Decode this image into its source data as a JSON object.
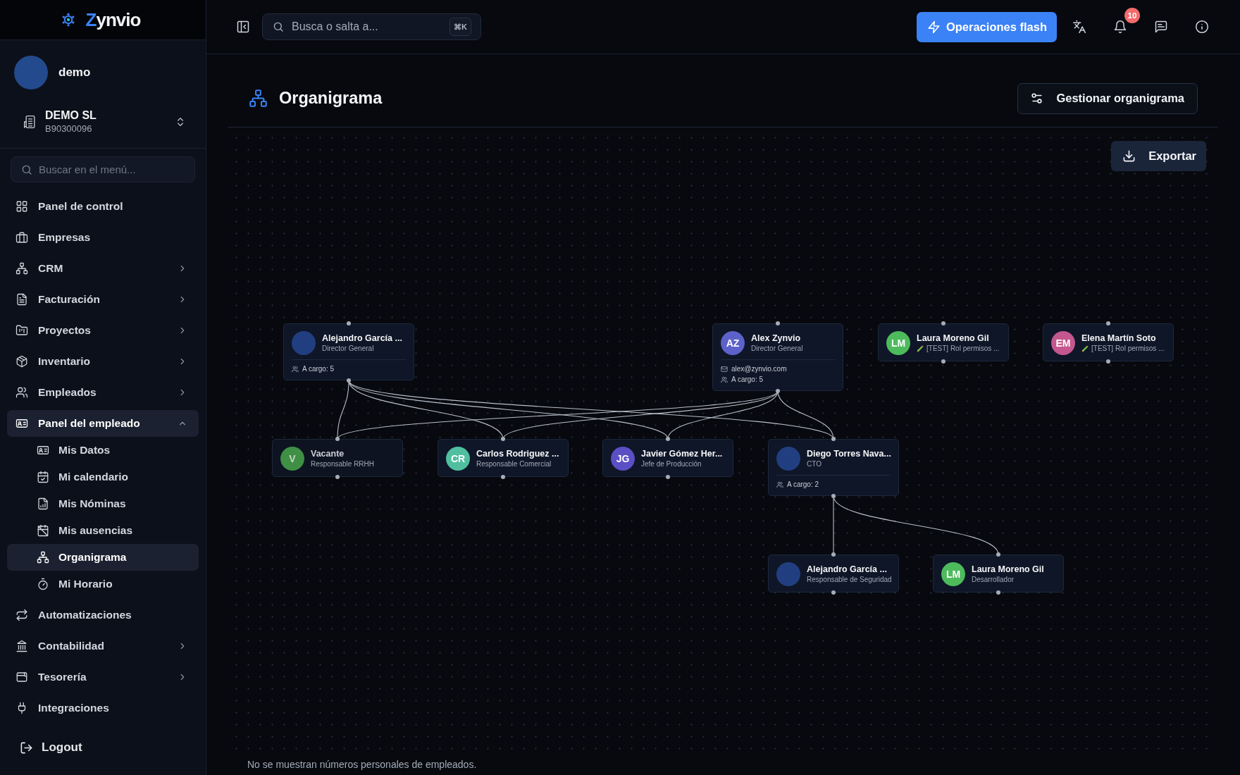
{
  "sidebar": {
    "logo": "Zynvio",
    "user": {
      "name": "demo"
    },
    "company": {
      "name": "DEMO SL",
      "tax_id": "B90300096"
    },
    "search": {
      "placeholder": "Buscar en el menú..."
    },
    "menu": [
      {
        "label": "Panel de control",
        "kind": "link",
        "expanded": false,
        "selected": false
      },
      {
        "label": "Empresas",
        "kind": "link",
        "expanded": false,
        "selected": false
      },
      {
        "label": "CRM",
        "kind": "group",
        "expanded": false,
        "selected": false
      },
      {
        "label": "Facturación",
        "kind": "group",
        "expanded": false,
        "selected": false
      },
      {
        "label": "Proyectos",
        "kind": "group",
        "expanded": false,
        "selected": false
      },
      {
        "label": "Inventario",
        "kind": "group",
        "expanded": false,
        "selected": false
      },
      {
        "label": "Empleados",
        "kind": "group",
        "expanded": false,
        "selected": false
      },
      {
        "label": "Panel del empleado",
        "kind": "group",
        "expanded": true,
        "selected": false,
        "children": [
          {
            "label": "Mis Datos",
            "selected": false
          },
          {
            "label": "Mi calendario",
            "selected": false
          },
          {
            "label": "Mis Nóminas",
            "selected": false
          },
          {
            "label": "Mis ausencias",
            "selected": false
          },
          {
            "label": "Organigrama",
            "selected": true
          },
          {
            "label": "Mi Horario",
            "selected": false
          }
        ]
      },
      {
        "label": "Automatizaciones",
        "kind": "link",
        "expanded": false,
        "selected": false
      },
      {
        "label": "Contabilidad",
        "kind": "group",
        "expanded": false,
        "selected": false
      },
      {
        "label": "Tesorería",
        "kind": "group",
        "expanded": false,
        "selected": false
      },
      {
        "label": "Integraciones",
        "kind": "link",
        "expanded": false,
        "selected": false
      }
    ],
    "logout": "Logout"
  },
  "topbar": {
    "search": {
      "placeholder": "Busca o salta a...",
      "shortcut": "⌘K"
    },
    "flash_button": "Operaciones flash",
    "notifications_badge": "10"
  },
  "page": {
    "title": "Organigrama",
    "manage_button": "Gestionar organigrama",
    "export_button": "Exportar",
    "org_chart": {
      "groups": [
        {
          "heads": [
            {
              "name": "Alejandro García ...",
              "role": "Director General",
              "color": "#213f80",
              "reports": "A cargo: 5",
              "marked": false,
              "vacant": false
            },
            {
              "name": "Alex Zynvio",
              "initials": "AZ",
              "role": "Director General",
              "color": "#5c62c9",
              "email": "alex@zynvio.com",
              "reports": "A cargo: 5",
              "marked": false,
              "vacant": false
            }
          ],
          "members": [
            {
              "name": "Vacante",
              "initials": "V",
              "role": "Responsable RRHH",
              "color": "#3f8f45",
              "marked": false,
              "vacant": true
            },
            {
              "name": "Carlos Rodriguez ...",
              "initials": "CR",
              "role": "Responsable Comercial",
              "color": "#4fbf9f",
              "marked": false,
              "vacant": false
            },
            {
              "name": "Javier Gómez Her...",
              "initials": "JG",
              "role": "Jefe de Producción",
              "color": "#5a4fc4",
              "marked": false,
              "vacant": false
            },
            {
              "name": "Diego Torres Nava...",
              "role": "CTO",
              "color": "#213f80",
              "reports": "A cargo: 2",
              "marked": false,
              "vacant": false,
              "children": [
                {
                  "name": "Alejandro García ...",
                  "role": "Responsable de Seguridad",
                  "color": "#213f80",
                  "marked": false,
                  "vacant": false
                },
                {
                  "name": "Laura Moreno Gil",
                  "initials": "LM",
                  "role": "Desarrollador",
                  "color": "#4dbb5c",
                  "marked": false,
                  "vacant": false
                }
              ]
            }
          ]
        }
      ],
      "standalone": [
        {
          "name": "Laura Moreno Gil",
          "initials": "LM",
          "role": "[TEST] Rol permisos ...",
          "color": "#4dbb5c",
          "marked": true,
          "vacant": false
        },
        {
          "name": "Elena Martín Soto",
          "initials": "EM",
          "role": "[TEST] Rol permisos ...",
          "color": "#c4578d",
          "marked": true,
          "vacant": false
        }
      ]
    },
    "footnote": "No se muestran números personales de empleados."
  }
}
